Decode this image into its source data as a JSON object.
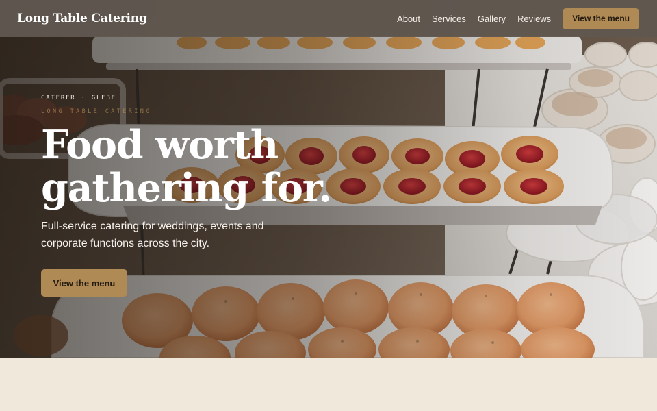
{
  "nav": {
    "brand": "Long Table Catering",
    "links": [
      "About",
      "Services",
      "Gallery",
      "Reviews"
    ],
    "cta_label": "View the menu"
  },
  "hero": {
    "eyebrow_left": "CATERER",
    "eyebrow_sep": "·",
    "eyebrow_right": "GLEBE",
    "wordmark": "LONG TABLE CATERING",
    "headline_line1": "Food worth",
    "headline_line2": "gathering for.",
    "subtext": "Full-service catering for weddings, events and corporate functions across the city.",
    "cta_label": "View the menu",
    "image_subject": "buffet-pastries-photo"
  },
  "colors": {
    "accent": "#b08a55",
    "nav_bg": "#605850",
    "page_bg": "#f1e8dc"
  }
}
